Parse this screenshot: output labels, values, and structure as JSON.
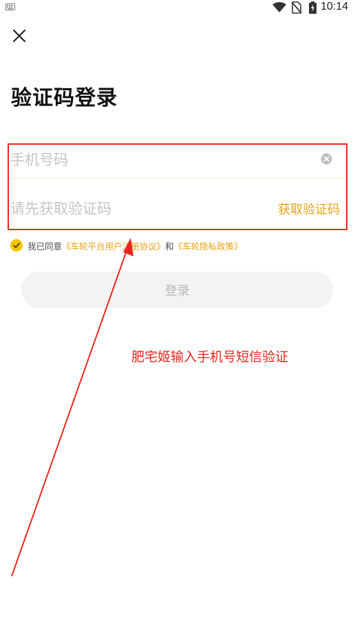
{
  "status_bar": {
    "time": "10:14"
  },
  "page": {
    "title": "验证码登录"
  },
  "phone_field": {
    "placeholder": "手机号码",
    "value": ""
  },
  "code_field": {
    "placeholder": "请先获取验证码",
    "value": "",
    "get_code_label": "获取验证码"
  },
  "agreement": {
    "checked": true,
    "prefix": "我已同意",
    "user_agreement": "《车轮平台用户注册协议》",
    "conjunction": "和",
    "privacy_policy": "《车轮隐私政策》"
  },
  "login_button": {
    "label": "登录"
  },
  "annotation": {
    "text": "肥宅姬输入手机号短信验证"
  },
  "colors": {
    "accent": "#F7C600",
    "link": "#E9A218",
    "annotation_red": "#E8261F",
    "button_bg": "#F2F3F5",
    "button_text": "#B9B9B9",
    "placeholder": "#C4C4C4"
  },
  "icons": {
    "status_left": "keyboard-icon",
    "status_right": [
      "wifi-icon",
      "no-sim-icon",
      "battery-charging-icon"
    ],
    "close": "close-icon",
    "clear": "clear-input-icon",
    "check": "checkmark-icon"
  }
}
